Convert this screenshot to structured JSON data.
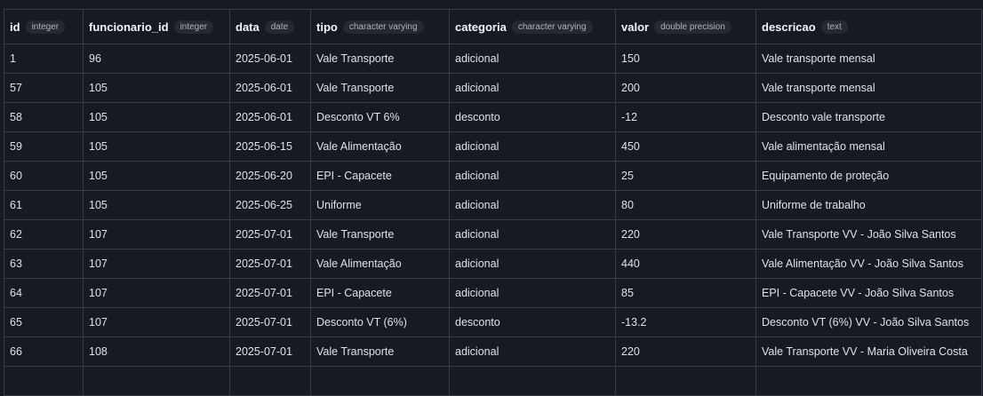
{
  "columns": [
    {
      "name": "id",
      "type": "integer"
    },
    {
      "name": "funcionario_id",
      "type": "integer"
    },
    {
      "name": "data",
      "type": "date"
    },
    {
      "name": "tipo",
      "type": "character varying"
    },
    {
      "name": "categoria",
      "type": "character varying"
    },
    {
      "name": "valor",
      "type": "double precision"
    },
    {
      "name": "descricao",
      "type": "text"
    }
  ],
  "rows": [
    [
      "1",
      "96",
      "2025-06-01",
      "Vale Transporte",
      "adicional",
      "150",
      "Vale transporte mensal"
    ],
    [
      "57",
      "105",
      "2025-06-01",
      "Vale Transporte",
      "adicional",
      "200",
      "Vale transporte mensal"
    ],
    [
      "58",
      "105",
      "2025-06-01",
      "Desconto VT 6%",
      "desconto",
      "-12",
      "Desconto vale transporte"
    ],
    [
      "59",
      "105",
      "2025-06-15",
      "Vale Alimentação",
      "adicional",
      "450",
      "Vale alimentação mensal"
    ],
    [
      "60",
      "105",
      "2025-06-20",
      "EPI - Capacete",
      "adicional",
      "25",
      "Equipamento de proteção"
    ],
    [
      "61",
      "105",
      "2025-06-25",
      "Uniforme",
      "adicional",
      "80",
      "Uniforme de trabalho"
    ],
    [
      "62",
      "107",
      "2025-07-01",
      "Vale Transporte",
      "adicional",
      "220",
      "Vale Transporte VV - João Silva Santos"
    ],
    [
      "63",
      "107",
      "2025-07-01",
      "Vale Alimentação",
      "adicional",
      "440",
      "Vale Alimentação VV - João Silva Santos"
    ],
    [
      "64",
      "107",
      "2025-07-01",
      "EPI - Capacete",
      "adicional",
      "85",
      "EPI - Capacete VV - João Silva Santos"
    ],
    [
      "65",
      "107",
      "2025-07-01",
      "Desconto VT (6%)",
      "desconto",
      "-13.2",
      "Desconto VT (6%) VV - João Silva Santos"
    ],
    [
      "66",
      "108",
      "2025-07-01",
      "Vale Transporte",
      "adicional",
      "220",
      "Vale Transporte VV - Maria Oliveira Costa"
    ],
    [
      "",
      "",
      "",
      "",
      "",
      "",
      ""
    ]
  ]
}
